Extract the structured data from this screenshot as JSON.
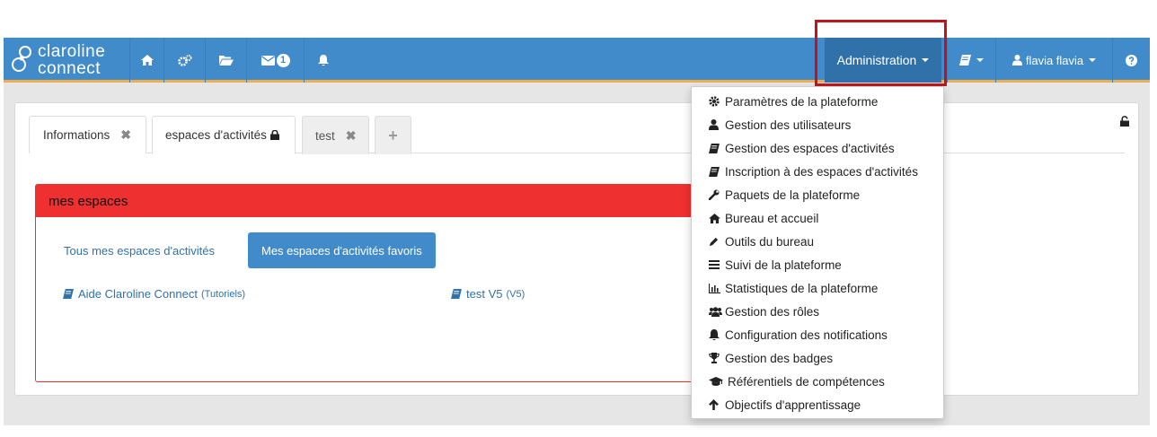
{
  "logo": {
    "line1": "claroline",
    "line2": "connect"
  },
  "navbar": {
    "notification_count": "1",
    "admin_label": "Administration",
    "user_label": "flavia flavia"
  },
  "tabs": [
    {
      "label": "Informations"
    },
    {
      "label": "espaces d'activités"
    },
    {
      "label": "test"
    }
  ],
  "widget": {
    "title": "mes espaces",
    "pill_all": "Tous mes espaces d'activités",
    "pill_fav": "Mes espaces d'activités favoris",
    "workspaces": [
      {
        "name": "Aide Claroline Connect",
        "code": "(Tutoriels)"
      },
      {
        "name": "test V5",
        "code": "(V5)"
      }
    ]
  },
  "admin_menu": [
    {
      "label": "Paramètres de la plateforme",
      "icon": "gear-icon"
    },
    {
      "label": "Gestion des utilisateurs",
      "icon": "user-icon"
    },
    {
      "label": "Gestion des espaces d'activités",
      "icon": "book-icon"
    },
    {
      "label": "Inscription à des espaces d'activités",
      "icon": "book-icon"
    },
    {
      "label": "Paquets de la plateforme",
      "icon": "wrench-icon"
    },
    {
      "label": "Bureau et accueil",
      "icon": "home-icon"
    },
    {
      "label": "Outils du bureau",
      "icon": "pencil-icon"
    },
    {
      "label": "Suivi de la plateforme",
      "icon": "list-icon"
    },
    {
      "label": "Statistiques de la plateforme",
      "icon": "bar-chart-icon"
    },
    {
      "label": "Gestion des rôles",
      "icon": "users-icon"
    },
    {
      "label": "Configuration des notifications",
      "icon": "bell-icon"
    },
    {
      "label": "Gestion des badges",
      "icon": "trophy-icon"
    },
    {
      "label": "Référentiels de compétences",
      "icon": "graduation-cap-icon"
    },
    {
      "label": "Objectifs d'apprentissage",
      "icon": "arrow-up-icon"
    }
  ],
  "colors": {
    "navbar": "#428bca",
    "accent_border": "#f0ad4e",
    "widget_red": "#ee3030",
    "highlight": "#c0141b"
  }
}
